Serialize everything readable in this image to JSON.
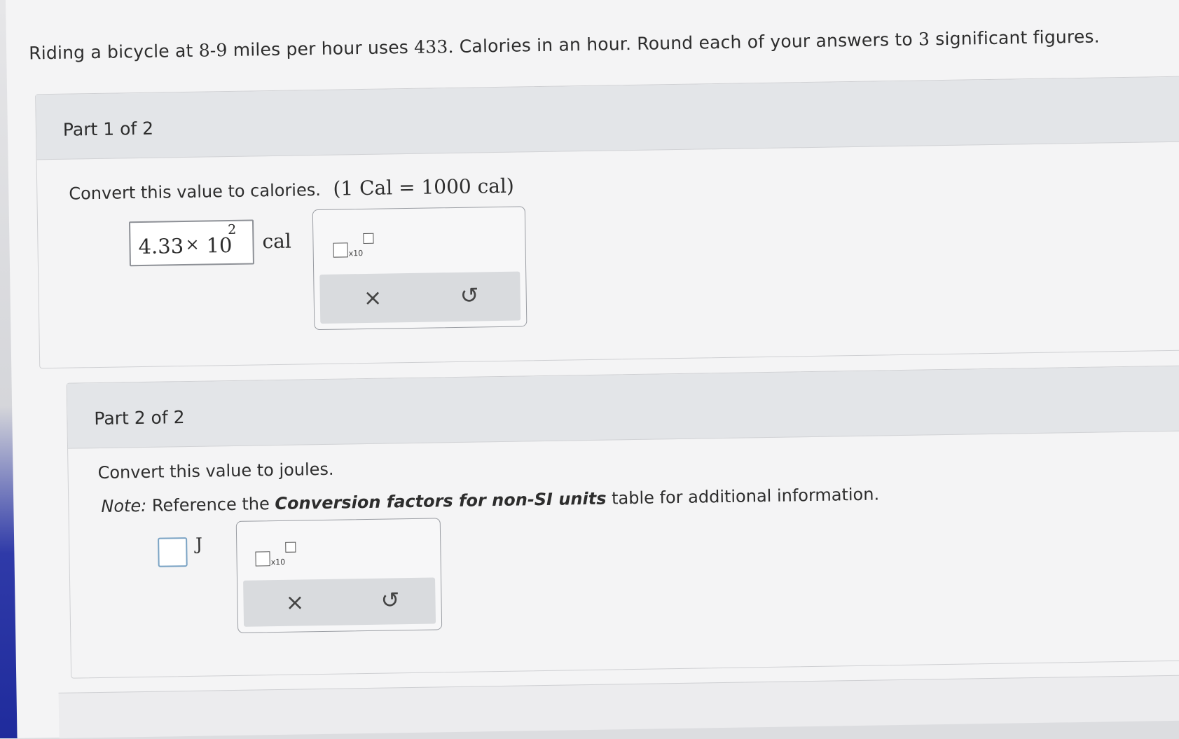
{
  "question": {
    "text_before": "Riding a bicycle at ",
    "speed": "8-9",
    "text_mid1": " miles per hour uses ",
    "calories": "433.",
    "text_mid2": " Calories in an hour. Round each of your answers to ",
    "sig_figs": "3",
    "text_after": " significant figures."
  },
  "part1": {
    "title": "Part 1 of 2",
    "instruction": "Convert this value to calories.",
    "conversion": "(1 Cal = 1000 cal)",
    "answer_mantissa": "4.33",
    "answer_times": "×",
    "answer_base": "10",
    "answer_exponent": "2",
    "unit": "cal",
    "toolbar": {
      "x10_label": "x10",
      "clear_icon": "×",
      "undo_icon": "↺"
    }
  },
  "part2": {
    "title": "Part 2 of 2",
    "instruction": "Convert this value to joules.",
    "note_label": "Note:",
    "note_text_before": " Reference the ",
    "note_link": "Conversion factors for non-SI units",
    "note_text_after": " table for additional information.",
    "answer_value": "",
    "unit": "J",
    "toolbar": {
      "x10_label": "x10",
      "clear_icon": "×",
      "undo_icon": "↺"
    }
  }
}
